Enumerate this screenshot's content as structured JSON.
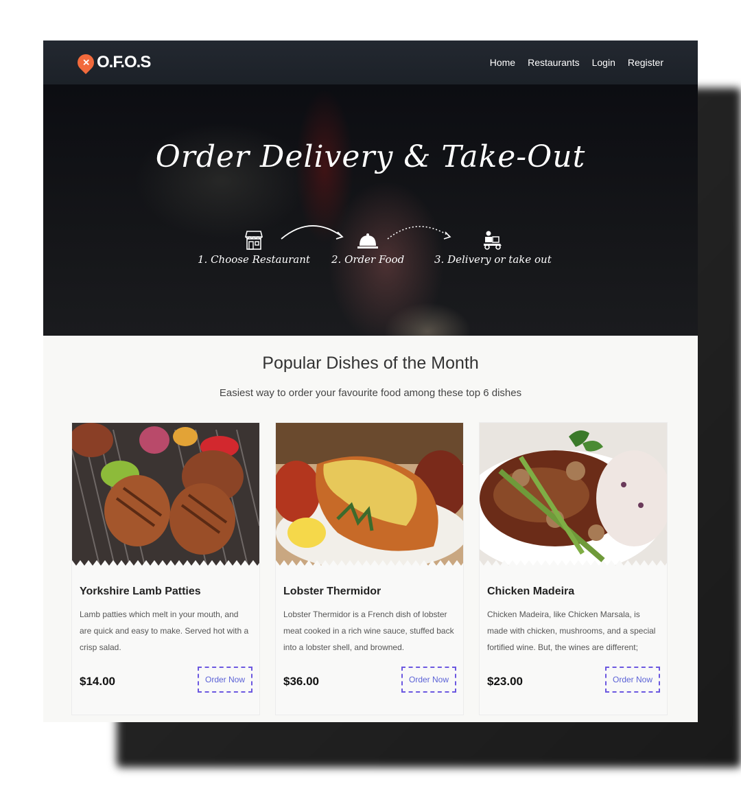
{
  "brand": {
    "logo_text": "O.F.O.S",
    "logo_mark": "✕",
    "accent": "#f26a3c"
  },
  "nav": {
    "items": [
      "Home",
      "Restaurants",
      "Login",
      "Register"
    ]
  },
  "hero": {
    "title": "Order Delivery & Take-Out",
    "steps": [
      {
        "label": "1. Choose Restaurant",
        "icon": "store-icon"
      },
      {
        "label": "2. Order Food",
        "icon": "cloche-icon"
      },
      {
        "label": "3. Delivery or take out",
        "icon": "delivery-scooter-icon"
      }
    ]
  },
  "popular": {
    "title": "Popular Dishes of the Month",
    "subtitle": "Easiest way to order your favourite food among these top 6 dishes",
    "dishes": [
      {
        "name": "Yorkshire Lamb Patties",
        "description": "Lamb patties which melt in your mouth, and are quick and easy to make. Served hot with a crisp salad.",
        "price": "$14.00",
        "button": "Order Now"
      },
      {
        "name": "Lobster Thermidor",
        "description": "Lobster Thermidor is a French dish of lobster meat cooked in a rich wine sauce, stuffed back into a lobster shell, and browned.",
        "price": "$36.00",
        "button": "Order Now"
      },
      {
        "name": "Chicken Madeira",
        "description": "Chicken Madeira, like Chicken Marsala, is made with chicken, mushrooms, and a special fortified wine. But, the wines are different;",
        "price": "$23.00",
        "button": "Order Now"
      }
    ]
  },
  "colors": {
    "button_border": "#6b57e0",
    "nav_bg": "#1f242b"
  }
}
